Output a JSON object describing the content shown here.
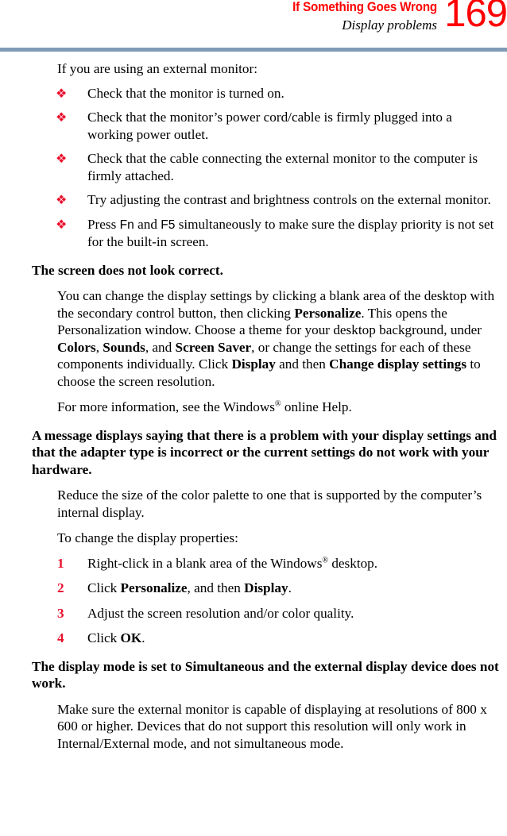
{
  "header": {
    "title": "If Something Goes Wrong",
    "subtitle": "Display problems",
    "page_number": "169",
    "title_color": "#ff0000",
    "page_number_color": "#ff0000",
    "rule_color": "#7e9ab5"
  },
  "content": {
    "intro": "If you are using an external monitor:",
    "bullets": [
      {
        "marker": "❖",
        "text": "Check that the monitor is turned on."
      },
      {
        "marker": "❖",
        "text": "Check that the monitor’s power cord/cable is firmly plugged into a working power outlet."
      },
      {
        "marker": "❖",
        "text": "Check that the cable connecting the external monitor to the computer is firmly attached."
      },
      {
        "marker": "❖",
        "text": "Try adjusting the contrast and brightness controls on the external monitor."
      },
      {
        "marker": "❖",
        "text_part1": "Press ",
        "key1": "Fn",
        "text_part2": " and ",
        "key2": "F5",
        "text_part3": " simultaneously to make sure the display priority is not set for the built-in screen."
      }
    ],
    "heading1": "The screen does not look correct.",
    "para1": {
      "s1": "You can change the display settings by clicking a blank area of the desktop with the secondary control button, then clicking ",
      "b1": "Personalize",
      "s2": ". This opens the Personalization window. Choose a theme for your desktop background, under ",
      "b2": "Colors",
      "s3": ", ",
      "b3": "Sounds",
      "s4": ", and ",
      "b4": "Screen Saver",
      "s5": ", or change the settings for each of these components individually. Click ",
      "b5": "Display",
      "s6": " and then ",
      "b6": "Change display settings",
      "s7": " to choose the screen resolution."
    },
    "para2": {
      "s1": "For more information, see the Windows",
      "sup": "®",
      "s2": " online Help."
    },
    "heading2": "A message displays saying that there is a problem with your display settings and that the adapter type is incorrect or the current settings do not work with your hardware.",
    "para3": "Reduce the size of the color palette to one that is supported by the computer’s internal display.",
    "para4": "To change the display properties:",
    "steps": [
      {
        "number": "1",
        "s1": "Right-click in a blank area of the Windows",
        "sup": "®",
        "s2": " desktop."
      },
      {
        "number": "2",
        "s1": "Click ",
        "b1": "Personalize",
        "s2": ", and then ",
        "b2": "Display",
        "s3": "."
      },
      {
        "number": "3",
        "s1": "Adjust the screen resolution and/or color quality."
      },
      {
        "number": "4",
        "s1": "Click ",
        "b1": "OK",
        "s2": "."
      }
    ],
    "heading3": "The display mode is set to Simultaneous and the external display device does not work.",
    "para5": "Make sure the external monitor is capable of displaying at resolutions of 800 x 600 or higher. Devices that do not support this resolution will only work in Internal/External mode, and not simultaneous mode."
  }
}
